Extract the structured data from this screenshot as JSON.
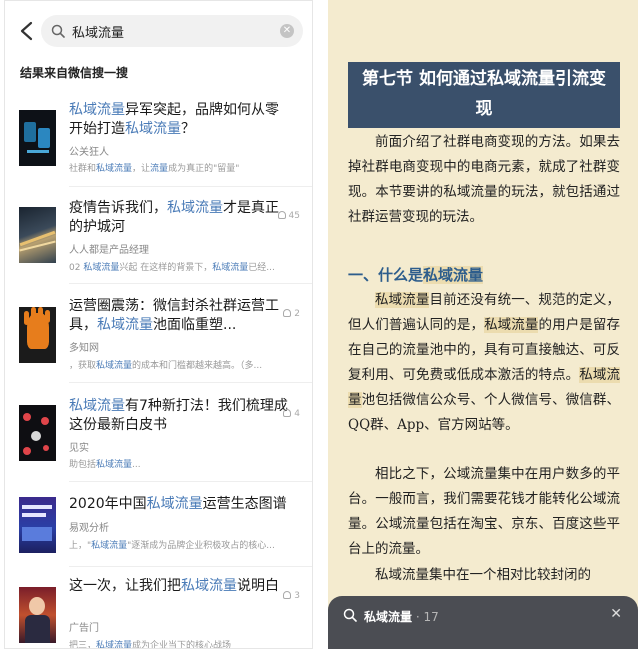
{
  "search": {
    "query": "私域流量"
  },
  "source_label": "结果来自微信搜一搜",
  "results": [
    {
      "title_a": "私域流量",
      "title_b": "异军突起，品牌如何从零开始打造",
      "title_c": "私域流量",
      "title_d": "？",
      "author": "公关狂人",
      "snippet_a": "社群和",
      "snippet_b": "私域流量",
      "snippet_c": "，让",
      "snippet_d": "流量",
      "snippet_e": "成为真正的\"留量\"",
      "count": ""
    },
    {
      "title_a": "疫情告诉我们，",
      "title_b": "私域流量",
      "title_c": "才是真正的护城河",
      "title_d": "",
      "author": "人人都是产品经理",
      "snippet_a": "02 ",
      "snippet_b": "私域流量",
      "snippet_c": "兴起 在这样的背景下，",
      "snippet_d": "私域流量",
      "snippet_e": "已经...",
      "count": "45"
    },
    {
      "title_a": "运营圈震荡：微信封杀社群运营工具，",
      "title_b": "私域流量",
      "title_c": "池面临重塑...",
      "title_d": "",
      "author": "多知网",
      "snippet_a": "，获取",
      "snippet_b": "私域流量",
      "snippet_c": "的成本和门槛都越来越高。（多...",
      "snippet_d": "",
      "snippet_e": "",
      "count": "2"
    },
    {
      "title_a": "私域流量",
      "title_b": "有7种新打法！我们梳理成这份最新白皮书",
      "title_c": "",
      "title_d": "",
      "author": "见实",
      "snippet_a": "助包括",
      "snippet_b": "私域流量",
      "snippet_c": "...",
      "snippet_d": "",
      "snippet_e": "",
      "count": "4"
    },
    {
      "title_a": "2020年中国",
      "title_b": "私域流量",
      "title_c": "运营生态图谱",
      "title_d": "",
      "author": "易观分析",
      "snippet_a": "上，\"",
      "snippet_b": "私域流量",
      "snippet_c": "\"逐渐成为品牌企业积极攻占的核心...",
      "snippet_d": "",
      "snippet_e": "",
      "count": ""
    },
    {
      "title_a": "这一次，让我们把",
      "title_b": "私域流量",
      "title_c": "说明白",
      "title_d": "",
      "author": "广告门",
      "snippet_a": "把三，",
      "snippet_b": "私域流量",
      "snippet_c": "成为企业当下的核心战场",
      "snippet_d": "",
      "snippet_e": "",
      "count": "3"
    }
  ],
  "book": {
    "banner": "第七节 如何通过私域流量引流变现",
    "p1": "前面介绍了社群电商变现的方法。如果去掉社群电商变现中的电商元素，就成了社群变现。本节要讲的私域流量的玩法，就包括通过社群运营变现的玩法。",
    "h2_a": "一、什么是",
    "h2_b": "私域流量",
    "p2_a": "私域流量",
    "p2_b": "目前还没有统一、规范的定义，但人们普遍认同的是，",
    "p2_c": "私域流量",
    "p2_d": "的用户是留存在自己的流量池中的，具有可直接触达、可反复利用、可免费或低成本激活的特点。",
    "p2_e": "私域流量",
    "p2_f": "池包括微信公众号、个人微信号、微信群、QQ群、App、官方网站等。",
    "p3": "相比之下，公域流量集中在用户数多的平台。一般而言，我们需要花钱才能转化公域流量。公域流量包括在淘宝、京东、百度这些平台上的流量。",
    "p4": "私域流量集中在一个相对比较封闭的"
  },
  "findbar": {
    "query": "私域流量",
    "count": " · 17",
    "close": "✕"
  },
  "colors": {
    "accent": "#4a7bb7",
    "banner": "#3a506b",
    "paper": "#f4ebcf",
    "findbar": "#4b4d53"
  }
}
